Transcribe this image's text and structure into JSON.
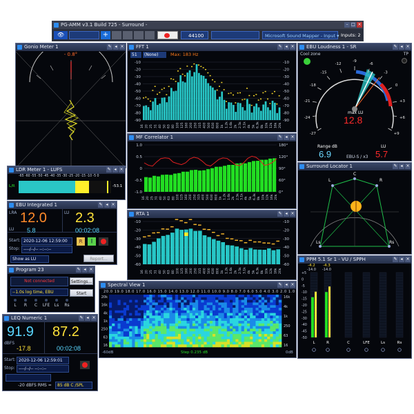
{
  "app": {
    "title": "PG-AMM v3.1 Build 725 - Surround -",
    "sample_rate": "44100",
    "device": "Microsoft Sound Mapper - Input",
    "inputs": "Inputs: 2"
  },
  "gonio": {
    "title": "Gonio Meter 1",
    "angle": "- 0.8°"
  },
  "fft": {
    "title": "FFT 1",
    "bands": "51",
    "preset": "(None)",
    "max": "Max: 183 Hz",
    "ylabels": [
      "-10",
      "-20",
      "-30",
      "-40",
      "-50",
      "-60",
      "-70",
      "-80",
      "-90"
    ],
    "xlabels": "16 20 25 31 40 50 63 80 100 125 160 200 250 315 400 500 630 800 1k 1.2k 1.6k 2k 2.5k 3.1k 4k 5k 6.3k 8k 10k 12k 16k 20k"
  },
  "corr": {
    "title": "MF Correlator 1",
    "right_labels": [
      "180°",
      "120°",
      "90°",
      "60°",
      "0°"
    ],
    "left_labels": [
      "1.0",
      "0.5",
      "0",
      "-0.5",
      "-1.0"
    ]
  },
  "rta": {
    "title": "RTA 1",
    "ylabels": [
      "-10",
      "-20",
      "-30",
      "-40",
      "-50",
      "-60"
    ]
  },
  "ebu_loud": {
    "title": "EBU Loudness 1 - SR",
    "cool_zone": "Cool zone",
    "tp": "TP",
    "max_label": "max LU",
    "max_value": "12.8",
    "range_label": "Range dB",
    "range_value": "6.9",
    "lu_label": "LU",
    "lu_value": "5.7",
    "mode": "EBU-S / x3",
    "scale": [
      "+9",
      "+6",
      "+3",
      "0",
      "-3",
      "-6",
      "-9",
      "-12",
      "-15",
      "-18",
      "-21",
      "-24",
      "-27"
    ]
  },
  "surround": {
    "title": "Surround Locator 1",
    "labels": [
      "L",
      "C",
      "R",
      "Ls",
      "Rs"
    ]
  },
  "ldr": {
    "title": "LDR Meter 1 - LUFS",
    "ch": "L/R",
    "value": "-53.1",
    "scale": "-65 -60 -55 -50 -45 -40 -35 -30 -25 -20 -15 -10 -5 0"
  },
  "ebu_int": {
    "title": "EBU Integrated 1",
    "lra_label": "LRA",
    "lra_value": "12.0",
    "lu_label": "LU",
    "lu_value": "2.3",
    "lu2_label": "LU",
    "lu2_value": "5.8",
    "time": "00:02:08",
    "start_label": "Start:",
    "start_value": "2020-12-06 12:59:00",
    "stop_label": "Stop:",
    "stop_value": "----/--/-- --:--:--",
    "show": "Show as LU",
    "report": "Report..."
  },
  "program": {
    "title": "Program 23",
    "status": "Not connected",
    "settings": "Settings...",
    "log": "--1.0s log time, EBU",
    "start": "Start",
    "channels": [
      "L",
      "R",
      "C",
      "LFE",
      "Ls",
      "Rs"
    ]
  },
  "spectral": {
    "title": "Spectral View 1",
    "top_labels": "20.0 19.0 18.0 17.0 16.0 15.0 14.0 13.0 12.0 11.0 10.0 9.0 8.0 7.0 6.0 5.0 4.0 3.0 2.0 1.0",
    "left": [
      "20k",
      "16k",
      "4k",
      "1k",
      "250",
      "63",
      "16"
    ],
    "right": [
      "16k",
      "4k",
      "1k",
      "250",
      "63",
      "16"
    ],
    "db_left": "-60dB",
    "step": "Step 0.235 dB",
    "db_right": "0dB"
  },
  "ppm": {
    "title": "PPM 5.1 Sr 1 - VU / SPPH",
    "tops": [
      "-4.2",
      "-4.3"
    ],
    "tops2": [
      "-14.0",
      "-14.0"
    ],
    "scale": [
      "+5",
      "0",
      "-5",
      "-10",
      "-15",
      "-20",
      "-25",
      "-30",
      "-40",
      "-45",
      "-50"
    ],
    "channels": [
      "L",
      "R",
      "C",
      "LFE",
      "Ls",
      "Rs"
    ]
  },
  "leq": {
    "title": "LEQ Numeric 1",
    "v1": "91.9",
    "v2": "87.2",
    "dbfs_label": "dBFS",
    "dbfs_value": "-17.8",
    "time": "00:02:08",
    "start_label": "Start:",
    "start_value": "2020-12-06 12:59:01",
    "stop_label": "Stop:",
    "stop_value": "----/--/-- --:--:--",
    "rms_label": "-20 dBFS RMS =",
    "rms_value": "85 dB C /SPL"
  },
  "colors": {
    "accent_orange": "#ff7a1a",
    "accent_cyan": "#5ad6ff",
    "bar_teal": "#27c6c6",
    "bar_green": "#22dd22"
  }
}
